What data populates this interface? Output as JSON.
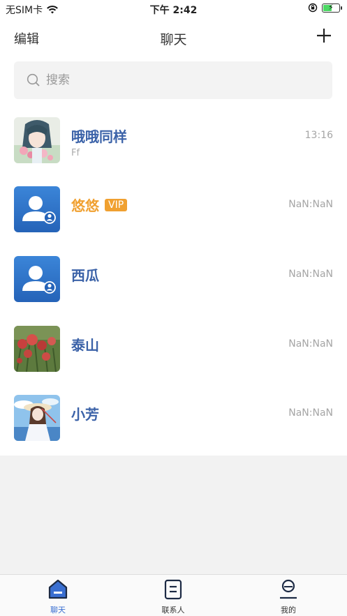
{
  "status": {
    "carrier": "无SIM卡",
    "time": "下午 2:42"
  },
  "nav": {
    "edit_label": "编辑",
    "title": "聊天"
  },
  "search": {
    "placeholder": "搜索"
  },
  "conversations": [
    {
      "name": "哦哦同样",
      "preview": "Ff",
      "time": "13:16",
      "avatar": "anime-girl-flowers"
    },
    {
      "name": "悠悠",
      "badge": "VIP",
      "time": "NaN:NaN",
      "avatar": "default-user-icon"
    },
    {
      "name": "西瓜",
      "time": "NaN:NaN",
      "avatar": "default-user-icon"
    },
    {
      "name": "泰山",
      "time": "NaN:NaN",
      "avatar": "red-flowers-photo"
    },
    {
      "name": "小芳",
      "time": "NaN:NaN",
      "avatar": "anime-girl-sky"
    }
  ],
  "tabs": [
    {
      "label": "聊天",
      "active": true
    },
    {
      "label": "联系人",
      "active": false
    },
    {
      "label": "我的",
      "active": false
    }
  ],
  "colors": {
    "accent": "#3a6fd1",
    "name_blue": "#3b62a8",
    "vip_orange": "#f0a030",
    "battery_green": "#4cd964"
  }
}
